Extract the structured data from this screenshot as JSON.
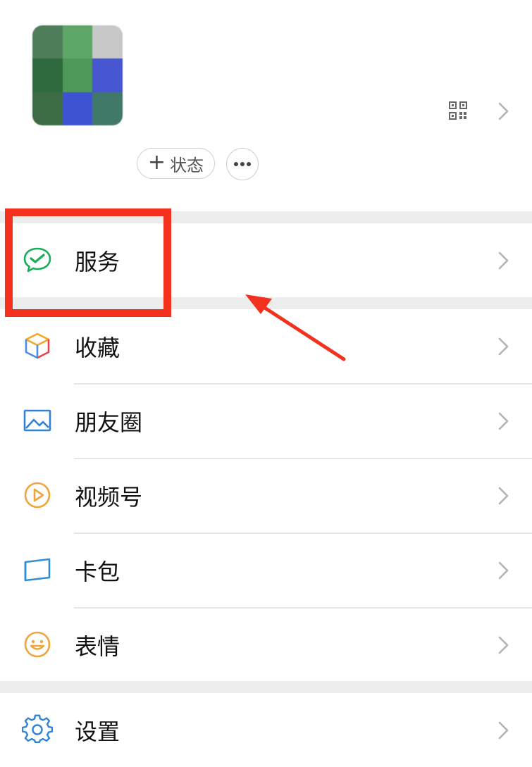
{
  "profile": {
    "status_button_plus": "+",
    "status_button_label": "状态",
    "more_label": "···",
    "avatar_colors": [
      "#4e7f5a",
      "#5ea568",
      "#c8c8c8",
      "#2f6a3e",
      "#4f9a5a",
      "#4657d1",
      "#3d6b44",
      "#3f52d3",
      "#40796a"
    ]
  },
  "menu": {
    "services": {
      "label": "服务",
      "icon": "wechat-pay-icon"
    },
    "items": [
      {
        "label": "收藏",
        "icon": "favorites-cube-icon"
      },
      {
        "label": "朋友圈",
        "icon": "moments-picture-icon"
      },
      {
        "label": "视频号",
        "icon": "channels-play-icon"
      },
      {
        "label": "卡包",
        "icon": "card-wallet-icon"
      },
      {
        "label": "表情",
        "icon": "sticker-smile-icon"
      }
    ],
    "settings": {
      "label": "设置",
      "icon": "settings-gear-icon"
    }
  },
  "annotation": {
    "highlight_color": "#f2321e",
    "target": "services"
  },
  "colors": {
    "accent_green": "#07c160",
    "chevron": "#b2b2b2",
    "separator": "#ededed"
  }
}
